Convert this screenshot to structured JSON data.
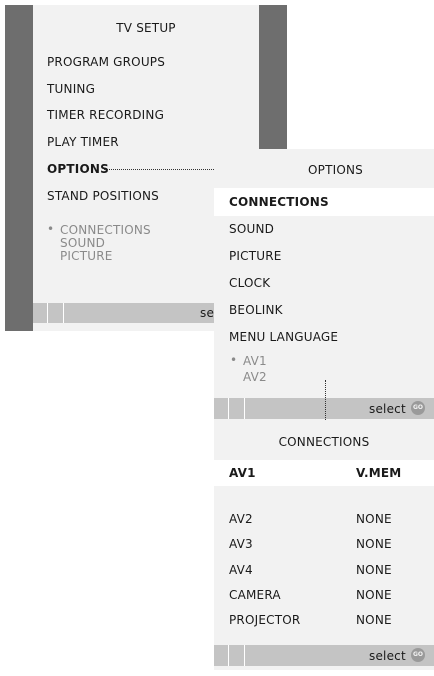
{
  "menu1": {
    "title": "TV SETUP",
    "items": [
      {
        "label": "PROGRAM GROUPS"
      },
      {
        "label": "TUNING"
      },
      {
        "label": "TIMER RECORDING"
      },
      {
        "label": "PLAY TIMER"
      },
      {
        "label": "OPTIONS"
      },
      {
        "label": "STAND POSITIONS"
      }
    ],
    "submenu_preview": [
      "CONNECTIONS",
      "SOUND",
      "PICTURE"
    ],
    "bullet": "•",
    "footer_select": "select"
  },
  "menu2": {
    "title": "OPTIONS",
    "items": [
      {
        "label": "CONNECTIONS"
      },
      {
        "label": "SOUND"
      },
      {
        "label": "PICTURE"
      },
      {
        "label": "CLOCK"
      },
      {
        "label": "BEOLINK"
      },
      {
        "label": "MENU LANGUAGE"
      }
    ],
    "submenu_preview": [
      "AV1",
      "AV2"
    ],
    "bullet": "•",
    "footer_select": "select",
    "footer_go": "GO"
  },
  "menu3": {
    "title": "CONNECTIONS",
    "rows": [
      {
        "label": "AV1",
        "value": "V.MEM"
      },
      {
        "label": "AV2",
        "value": "NONE"
      },
      {
        "label": "AV3",
        "value": "NONE"
      },
      {
        "label": "AV4",
        "value": "NONE"
      },
      {
        "label": "CAMERA",
        "value": "NONE"
      },
      {
        "label": "PROJECTOR",
        "value": "NONE"
      }
    ],
    "footer_select": "select",
    "footer_go": "GO"
  },
  "colors": {
    "side_panel": "#6e6e6e",
    "menu_bg": "#f2f2f2",
    "footer_bar": "#c4c4c4",
    "highlight_text": "#1a1a1a",
    "inactive_text": "#8a8a8a"
  }
}
